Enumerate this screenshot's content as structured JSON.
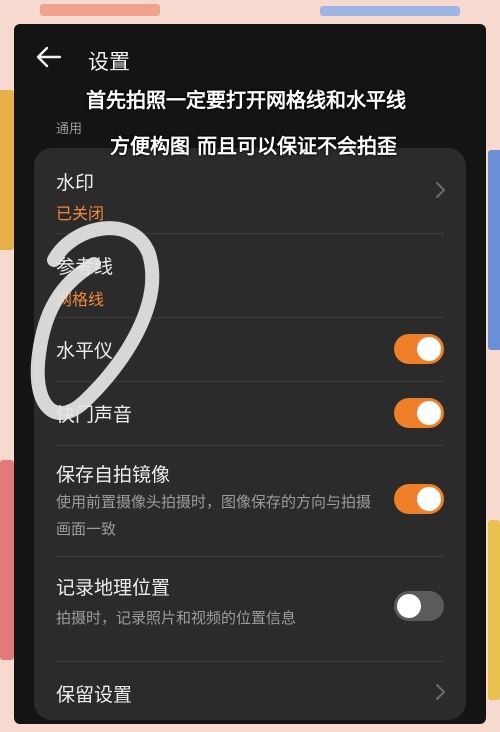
{
  "header": {
    "title": "设置"
  },
  "section": {
    "label": "通用"
  },
  "captions": {
    "line1": "首先拍照一定要打开网格线和水平线",
    "line2": "方便构图 而且可以保证不会拍歪"
  },
  "settings": {
    "watermark": {
      "title": "水印",
      "value": "已关闭"
    },
    "guide_lines": {
      "title": "参考线",
      "value": "网格线"
    },
    "level": {
      "title": "水平仪",
      "enabled": true
    },
    "shutter_sound": {
      "title": "快门声音",
      "enabled": true
    },
    "mirror_selfie": {
      "title": "保存自拍镜像",
      "description": "使用前置摄像头拍摄时，图像保存的方向与拍摄画面一致",
      "enabled": true
    },
    "location": {
      "title": "记录地理位置",
      "description": "拍摄时，记录照片和视频的位置信息",
      "enabled": false
    },
    "keep_settings": {
      "title": "保留设置"
    }
  },
  "colors": {
    "accent": "#f07f2a",
    "background": "#141414",
    "card": "#2b2b2b"
  }
}
